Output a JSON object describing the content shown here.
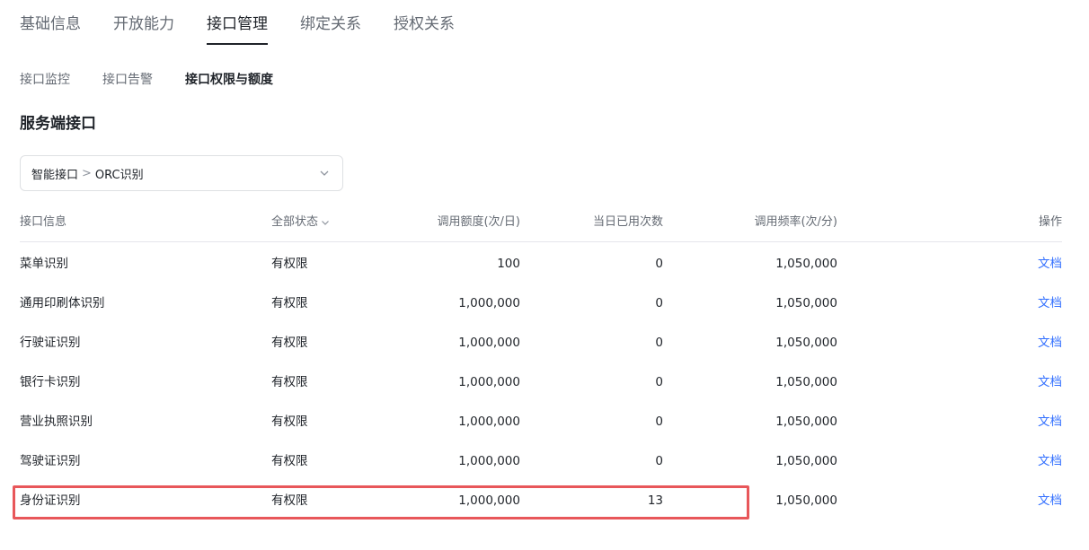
{
  "tabs": [
    {
      "label": "基础信息",
      "active": false
    },
    {
      "label": "开放能力",
      "active": false
    },
    {
      "label": "接口管理",
      "active": true
    },
    {
      "label": "绑定关系",
      "active": false
    },
    {
      "label": "授权关系",
      "active": false
    }
  ],
  "subtabs": [
    {
      "label": "接口监控",
      "active": false
    },
    {
      "label": "接口告警",
      "active": false
    },
    {
      "label": "接口权限与额度",
      "active": true
    }
  ],
  "section": {
    "title": "服务端接口"
  },
  "selector": {
    "category": "智能接口",
    "separator": ">",
    "value": "ORC识别"
  },
  "table": {
    "headers": {
      "name": "接口信息",
      "status": "全部状态",
      "quota": "调用额度(次/日)",
      "used": "当日已用次数",
      "rate": "调用频率(次/分)",
      "op": "操作"
    },
    "rows": [
      {
        "name": "菜单识别",
        "status": "有权限",
        "quota": "100",
        "used": "0",
        "rate": "1,050,000",
        "op": "文档"
      },
      {
        "name": "通用印刷体识别",
        "status": "有权限",
        "quota": "1,000,000",
        "used": "0",
        "rate": "1,050,000",
        "op": "文档"
      },
      {
        "name": "行驶证识别",
        "status": "有权限",
        "quota": "1,000,000",
        "used": "0",
        "rate": "1,050,000",
        "op": "文档"
      },
      {
        "name": "银行卡识别",
        "status": "有权限",
        "quota": "1,000,000",
        "used": "0",
        "rate": "1,050,000",
        "op": "文档"
      },
      {
        "name": "营业执照识别",
        "status": "有权限",
        "quota": "1,000,000",
        "used": "0",
        "rate": "1,050,000",
        "op": "文档"
      },
      {
        "name": "驾驶证识别",
        "status": "有权限",
        "quota": "1,000,000",
        "used": "0",
        "rate": "1,050,000",
        "op": "文档"
      },
      {
        "name": "身份证识别",
        "status": "有权限",
        "quota": "1,000,000",
        "used": "13",
        "rate": "1,050,000",
        "op": "文档"
      }
    ]
  },
  "colors": {
    "accent_link": "#3370ff",
    "highlight_border": "#e8575a"
  },
  "icons": {
    "selector_chevron": "chevron-down-icon",
    "status_filter": "chevron-down-icon"
  }
}
